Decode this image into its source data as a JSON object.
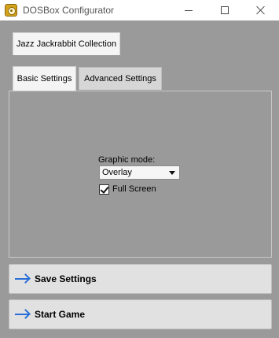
{
  "window": {
    "title": "DOSBox Configurator",
    "icon": "dosbox-gear-icon"
  },
  "game_tab": {
    "label": "Jazz Jackrabbit Collection"
  },
  "tabs": [
    {
      "label": "Basic Settings",
      "selected": true
    },
    {
      "label": "Advanced Settings",
      "selected": false
    }
  ],
  "basic": {
    "graphic_mode_label": "Graphic mode:",
    "graphic_mode_value": "Overlay",
    "fullscreen_label": "Full Screen",
    "fullscreen_checked": true
  },
  "buttons": {
    "save_label": "Save Settings",
    "start_label": "Start Game",
    "icon": "arrow-right-icon",
    "icon_color": "#2a6fd6"
  },
  "colors": {
    "background": "#9a9a9a",
    "button_face": "#e1e1e1"
  }
}
